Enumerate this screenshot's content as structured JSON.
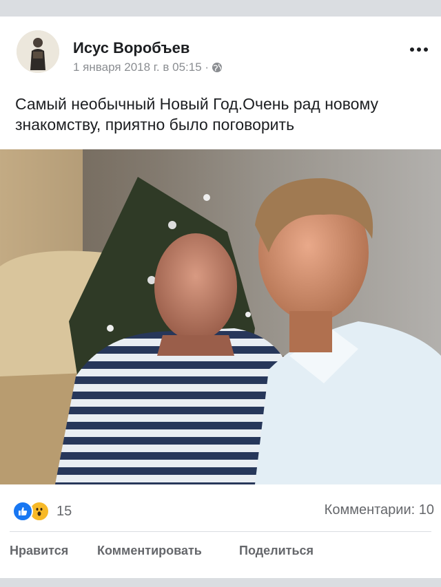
{
  "post": {
    "author": "Исус Воробъев",
    "date": "1 января 2018 г. в 05:15 ·",
    "text": "Самый необычный Новый Год.Очень рад новому знакомству, приятно было поговорить"
  },
  "stats": {
    "reactions_count": "15",
    "comments": "Комментарии: 10"
  },
  "actions": {
    "like": "Нравится",
    "comment": "Комментировать",
    "share": "Поделиться"
  },
  "icons": {
    "more": "more-options-icon",
    "privacy": "globe-icon",
    "like": "like-reaction-icon",
    "wow": "wow-reaction-icon"
  },
  "colors": {
    "like_blue": "#1877f2",
    "wow_yellow": "#f7b928",
    "secondary_text": "#65676b"
  }
}
